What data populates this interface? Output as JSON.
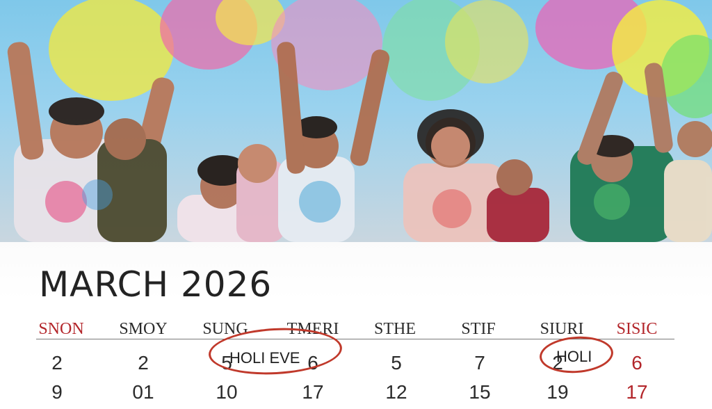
{
  "calendar": {
    "title": "MARCH 2026",
    "weekdays": [
      {
        "label": "SNON"
      },
      {
        "label": "SMOY"
      },
      {
        "label": "SUNG"
      },
      {
        "label": "TMERI"
      },
      {
        "label": "STHE"
      },
      {
        "label": "STIF"
      },
      {
        "label": "SIURI"
      },
      {
        "label": "SISIC"
      }
    ],
    "week1": [
      "2",
      "2",
      "5",
      "6",
      "5",
      "7",
      "2",
      "6"
    ],
    "week2": [
      "9",
      "01",
      "10",
      "17",
      "12",
      "15",
      "19",
      "17"
    ],
    "notes": {
      "holi_eve": "HOLI EVE",
      "holi": "HOLI"
    }
  },
  "colors": {
    "weekend_red": "#b3262b",
    "circle_red": "#c0392b",
    "title_dark": "#232323"
  }
}
